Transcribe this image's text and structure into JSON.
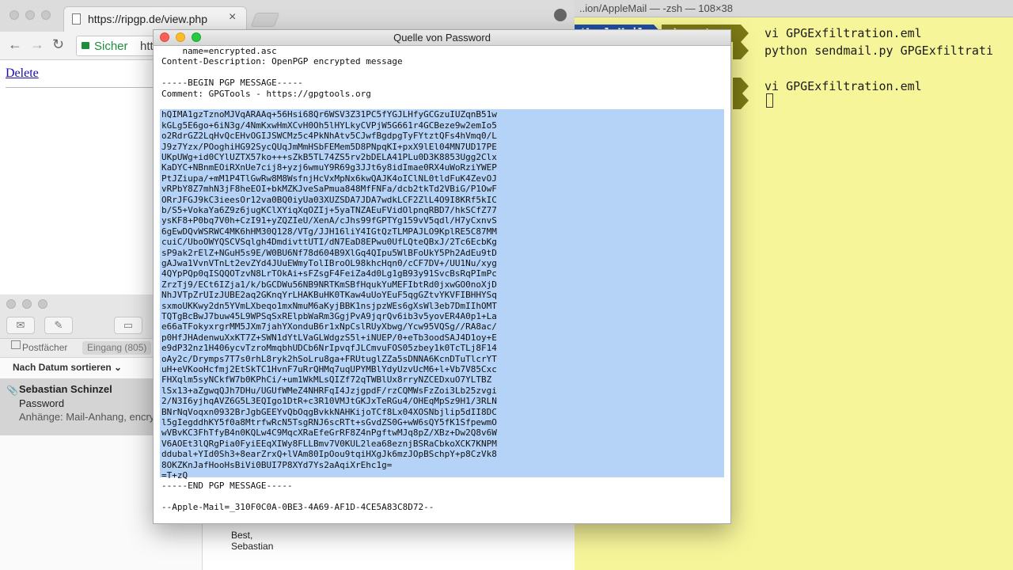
{
  "browser": {
    "tab_title": "https://ripgp.de/view.php",
    "tab_close": "×",
    "url_secure_label": "Sicher",
    "url_host": "htt",
    "nav_back": "←",
    "nav_forward": "→",
    "nav_reload": "↻",
    "delete_link": "Delete"
  },
  "terminal": {
    "title": "..ion/AppleMail — -zsh — 108×38",
    "prompt_dir": "/AppleMail",
    "prompt_branch": "master",
    "commands": [
      "vi GPGExfiltration.eml",
      "python sendmail.py GPGExfiltrati",
      "vi GPGExfiltration.eml"
    ]
  },
  "mail": {
    "favorites_postfaecher": "Postfächer",
    "favorites_eingang": "Eingang (805)",
    "sort_label": "Nach Datum sortieren",
    "list_item": {
      "sender": "Sebastian Schinzel",
      "subject": "Password",
      "preview": "Anhänge: Mail-Anhang, encry"
    },
    "signature_best": "Best,",
    "signature_name": "Sebastian"
  },
  "source_window": {
    "title": "Quelle von Password",
    "header_lines": [
      "    name=encrypted.asc",
      "Content-Description: OpenPGP encrypted message",
      "",
      "-----BEGIN PGP MESSAGE-----",
      "Comment: GPGTools - https://gpgtools.org",
      ""
    ],
    "pgp_lines": [
      "hQIMA1gzTznoMJVqARAAq+56Hsi68Qr6WSV3Z31PC5fYGJLHfyGCGzuIUZqnB51w",
      "kGLg5E6go+6iN3g/4NmKxwHmXCvH0Oh5lHYLkyCVPjW5G661r4GCBeze9w2emIo5",
      "o2RdrGZ2LqHvQcEHvOGIJSWCMz5c4PkNhAtv5CJwfBgdpgTyFYtztQFs4hVmq0/L",
      "J9z7Yzx/POoghiHG92SycQUqJmMmHSbFEMem5D8PNpqKI+pxX9lEl04MN7UD17PE",
      "UKpUWg+id0CYlUZTX57ko+++sZkB5TL74ZS5rv2bDELA41PLu0D3K8853Ugg2Clx",
      "KaDYC+NBnmEOiRXnUe7cij8+yzj6wmuY9R69g3JJt6y8idImae0RX4uWoRziYWEP",
      "PtJZiupa/+mM1P4TlGwRw8M8WsfnjHcVxMpNx6kwQAJK4oIClNL0tldFuK4ZevOJ",
      "vRPbY8Z7mhN3jF8heEOI+bkMZKJveSaPmua848MfFNFa/dcb2tkTd2VBiG/P1OwF",
      "ORrJFGJ9kC3ieesOr12va0BQ0iyUa03XUZSDA7JDA7wdkLCF2ZlL4O9I8KRf5kIC",
      "b/S5+VokaYa6Z9z6jugKClXYiqXqOZIj+5yaTNZAEuFVidOlpnqRBD7/hkSCfZ77",
      "ysKF8+P0bq7V0h+CzI91+yZQZIeU/XenA/cJhs99fGPTYg159vV5qdl/H7yCxnvS",
      "6gEwDQvWSRWC4MK6hHM30Q128/VTg/JJH16liY4IGtQzTLMPAJLO9KplRE5C87MM",
      "cuiC/UboOWYQSCVSqlgh4DmdivttUTI/dN7EaD8EPwu0UfLQteQBxJ/2Tc6EcbKg",
      "sP9ak2rElZ+NGuH5s9E/W0BU6Nf78d604B9XlGq4QIpu5WlBFoUkY5Ph2AdEu9tD",
      "gAJwa1VvnVTnLt2evZYd4JUuEWmyTolIBroOL98khcHqn0/cCF7DV+/UU1Nu/xyg",
      "4QYpPQp0qISQQOTzvN8LrTOkAi+sFZsgF4FeiZa4d0Lg1gB93y91SvcBsRqPImPc",
      "ZrzTj9/ECt6IZja1/k/bGCDWu56NB9NRTKmSBfHqukYuMEFIbtRd0jxwGO0noXjD",
      "NhJVTpZrUIzJUBE2aq2GKnqYrLHAKBuHK0TKaw4uUoYEuF5qgGZtvYKVFIBHHYSq",
      "sxmoUKKwy2dn5YVmLXbeqo1mxNmuM6aKyjBBK1nsjpzWEs6gXsWl3eb7DmIIhOMT",
      "TQTgBcBwJ7buw45L9WPSqSxRElpbWaRm3GgjPvA9jqrQv6ib3v5yovER4A0p1+La",
      "e66aTFokyxrgrMM5JXm7jahYXonduB6r1xNpCslRUyXbwg/Ycw95VQSg//RA8ac/",
      "p0HfJHAdenwuXxKT7Z+SWN1dYtLVaGLWdgzS5l+iNUEP/0+eTb3oodSAJ4D1oy+E",
      "e9dP32nz1H406ycvTzroMmqbhUDCb6NrIpvqfJLCmvuFOS05zbey1k0TcTLj8F14",
      "oAy2c/Drymps7T7s0rhL8ryk2hSoLru8ga+FRUtuglZZa5sDNNA6KcnDTuTlcrYT",
      "uH+eVKooHcfmj2EtSkTC1HvnF7uRrQHMq7uqUPYMBlYdyUzvUcM6+l+Vb7V85Cxc",
      "FHXqlm5syNCkfW7b0KPhCi/+um1WkMLsQIZf72qTWBlUx8rryNZCEDxuO7YLTBZ",
      "lSx13+aZgwqQJh7DHu/UGUfWMeZ4NHRFqI4JzjgpdF/rzCQMWsFzZoi3Lb25zvgi",
      "2/N3I6yjhqAVZ6G5L3EQIgo1DtR+c3R10VMJtGKJxTeRGu4/OHEqMpSz9H1/3RLN",
      "BNrNqVoqxn0932BrJgbGEEYvQbOqgBvkkNAHKijoTCf8Lx04XOSNbjlip5dII8DC",
      "l5gIegddhKY5f0a8MtrfwRcN5TsgRNJ6scRTt+sGvdZS0G+wW6sQY5fK1SfpewmO",
      "wVBvKC3FhTfyB4n0KQLw4C9MqcXRaEfeGrRF8Z4nPgftwMJq8pZ/XBz+Dw2Q8v6W",
      "V6AOEt3lQRgPia0FyiEEqXIWy8FLLBmv7V0KUL2lea68eznjBSRaCbkoXCK7KNPM",
      "ddubal+YId0Sh3+8earZrxQ+lVAm80IpOou9tqiHXgJk6mzJOpBSchpY+p8CzVk8",
      "8OKZKnJafHooHsBiVi0BUI7P8XYd7Ys2aAqiXrEhc1g=",
      "=T+zQ"
    ],
    "footer_lines": [
      "-----END PGP MESSAGE-----",
      "",
      "--Apple-Mail=_310F0C0A-0BE3-4A69-AF1D-4CE5A83C8D72--"
    ]
  },
  "colors": {
    "selection": "#b5d3f7",
    "terminal_bg": "#f7f59a",
    "link": "#1a0dab",
    "secure_green": "#1a8f3c"
  }
}
